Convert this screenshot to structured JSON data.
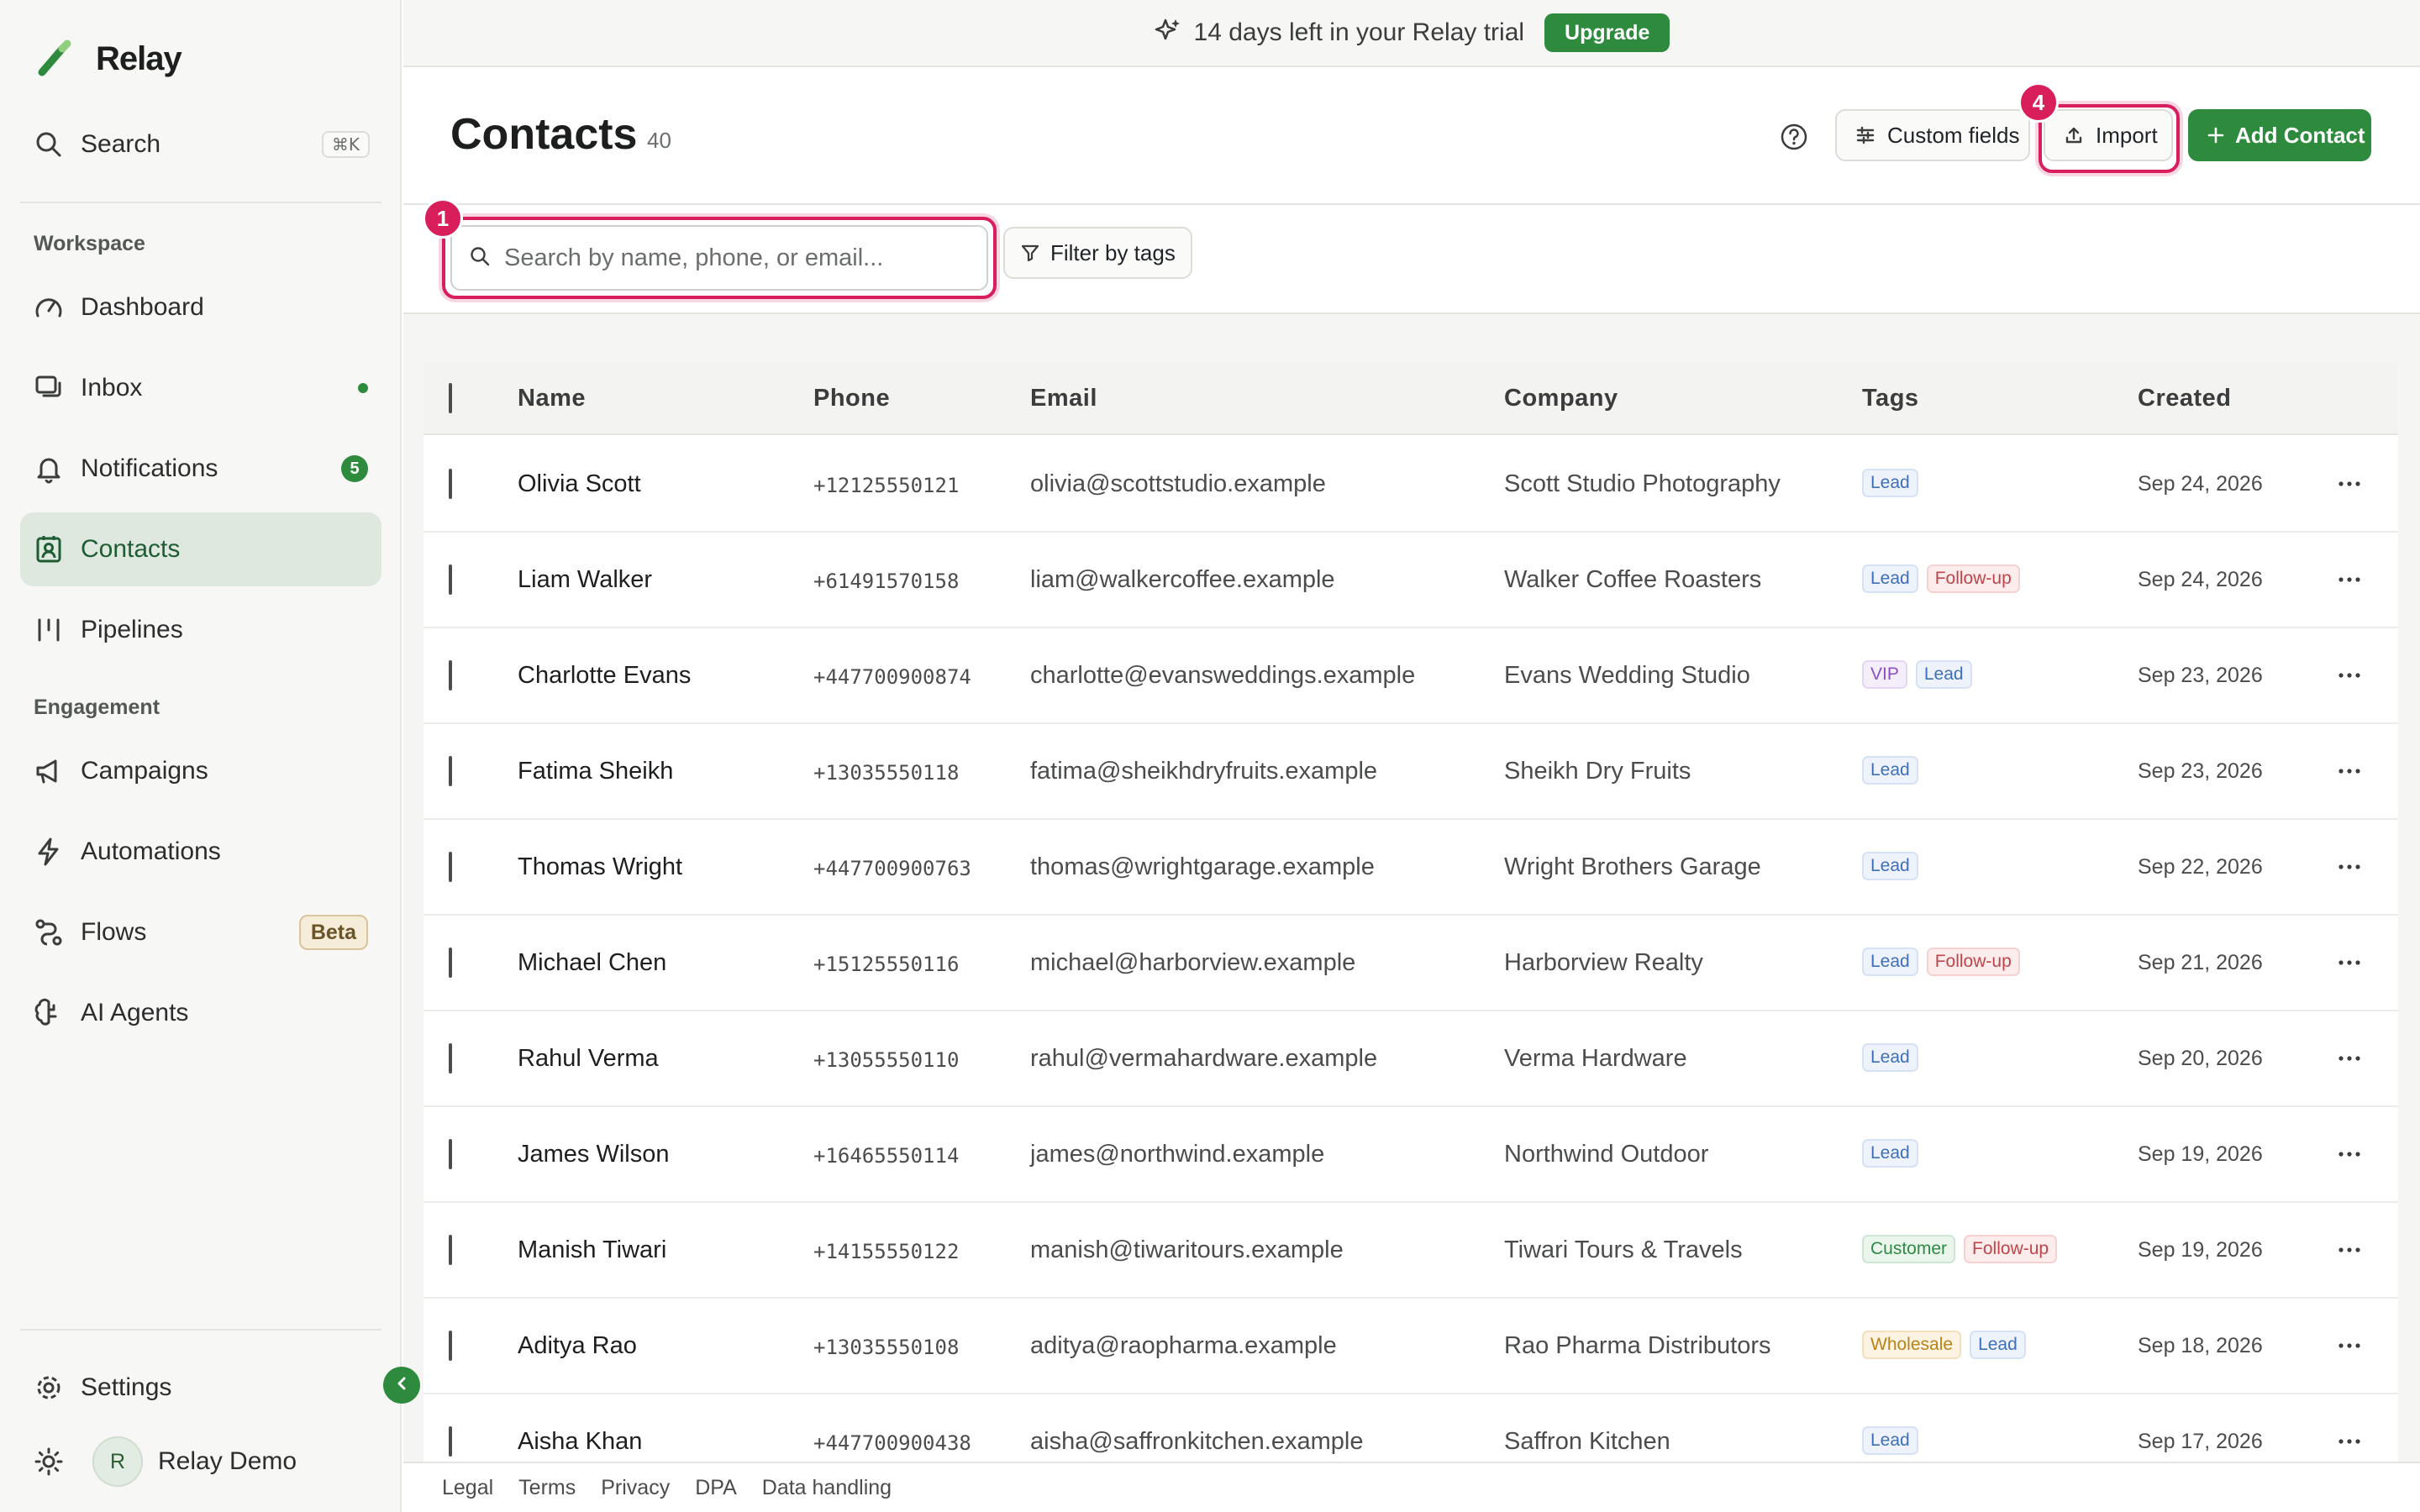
{
  "app": {
    "name": "Relay"
  },
  "sidebar": {
    "search_label": "Search",
    "search_shortcut": "⌘K",
    "sections": {
      "workspace": "Workspace",
      "engagement": "Engagement"
    },
    "items": [
      {
        "label": "Dashboard",
        "icon": "gauge-icon"
      },
      {
        "label": "Inbox",
        "icon": "inbox-icon"
      },
      {
        "label": "Notifications",
        "icon": "bell-icon",
        "badge": "5"
      },
      {
        "label": "Contacts",
        "icon": "contacts-icon",
        "active": true
      },
      {
        "label": "Pipelines",
        "icon": "pipeline-icon"
      },
      {
        "label": "Campaigns",
        "icon": "megaphone-icon"
      },
      {
        "label": "Automations",
        "icon": "bolt-icon"
      },
      {
        "label": "Flows",
        "icon": "flow-icon",
        "badge": "Beta"
      },
      {
        "label": "AI Agents",
        "icon": "brain-icon"
      }
    ],
    "settings_label": "Settings",
    "user": {
      "initial": "R",
      "name": "Relay Demo"
    }
  },
  "banner": {
    "message": "14 days left in your Relay trial",
    "cta": "Upgrade"
  },
  "header": {
    "title": "Contacts",
    "count": "40",
    "custom_fields_label": "Custom fields",
    "import_label": "Import",
    "add_contact_label": "Add Contact"
  },
  "search": {
    "placeholder": "Search by name, phone, or email...",
    "value": ""
  },
  "filter": {
    "label": "Filter by tags"
  },
  "markers": {
    "search": "1",
    "import": "4"
  },
  "table": {
    "columns": [
      "Name",
      "Phone",
      "Email",
      "Company",
      "Tags",
      "Created"
    ],
    "rows": [
      {
        "name": "Olivia Scott",
        "phone": "+12125550121",
        "email": "olivia@scottstudio.example",
        "company": "Scott Studio Photography",
        "tags": [
          "Lead"
        ],
        "created": "Sep 24, 2026"
      },
      {
        "name": "Liam Walker",
        "phone": "+61491570158",
        "email": "liam@walkercoffee.example",
        "company": "Walker Coffee Roasters",
        "tags": [
          "Lead",
          "Follow-up"
        ],
        "created": "Sep 24, 2026"
      },
      {
        "name": "Charlotte Evans",
        "phone": "+447700900874",
        "email": "charlotte@evansweddings.example",
        "company": "Evans Wedding Studio",
        "tags": [
          "VIP",
          "Lead"
        ],
        "created": "Sep 23, 2026"
      },
      {
        "name": "Fatima Sheikh",
        "phone": "+13035550118",
        "email": "fatima@sheikhdryfruits.example",
        "company": "Sheikh Dry Fruits",
        "tags": [
          "Lead"
        ],
        "created": "Sep 23, 2026"
      },
      {
        "name": "Thomas Wright",
        "phone": "+447700900763",
        "email": "thomas@wrightgarage.example",
        "company": "Wright Brothers Garage",
        "tags": [
          "Lead"
        ],
        "created": "Sep 22, 2026"
      },
      {
        "name": "Michael Chen",
        "phone": "+15125550116",
        "email": "michael@harborview.example",
        "company": "Harborview Realty",
        "tags": [
          "Lead",
          "Follow-up"
        ],
        "created": "Sep 21, 2026"
      },
      {
        "name": "Rahul Verma",
        "phone": "+13055550110",
        "email": "rahul@vermahardware.example",
        "company": "Verma Hardware",
        "tags": [
          "Lead"
        ],
        "created": "Sep 20, 2026"
      },
      {
        "name": "James Wilson",
        "phone": "+16465550114",
        "email": "james@northwind.example",
        "company": "Northwind Outdoor",
        "tags": [
          "Lead"
        ],
        "created": "Sep 19, 2026"
      },
      {
        "name": "Manish Tiwari",
        "phone": "+14155550122",
        "email": "manish@tiwaritours.example",
        "company": "Tiwari Tours & Travels",
        "tags": [
          "Customer",
          "Follow-up"
        ],
        "created": "Sep 19, 2026"
      },
      {
        "name": "Aditya Rao",
        "phone": "+13035550108",
        "email": "aditya@raopharma.example",
        "company": "Rao Pharma Distributors",
        "tags": [
          "Wholesale",
          "Lead"
        ],
        "created": "Sep 18, 2026"
      },
      {
        "name": "Aisha Khan",
        "phone": "+447700900438",
        "email": "aisha@saffronkitchen.example",
        "company": "Saffron Kitchen",
        "tags": [
          "Lead"
        ],
        "created": "Sep 17, 2026"
      }
    ]
  },
  "footer": {
    "links": [
      "Legal",
      "Terms",
      "Privacy",
      "DPA",
      "Data handling"
    ]
  },
  "colors": {
    "accent": "#2e8b3e",
    "highlight": "#d81e5b",
    "active_bg": "#dfe8df"
  }
}
